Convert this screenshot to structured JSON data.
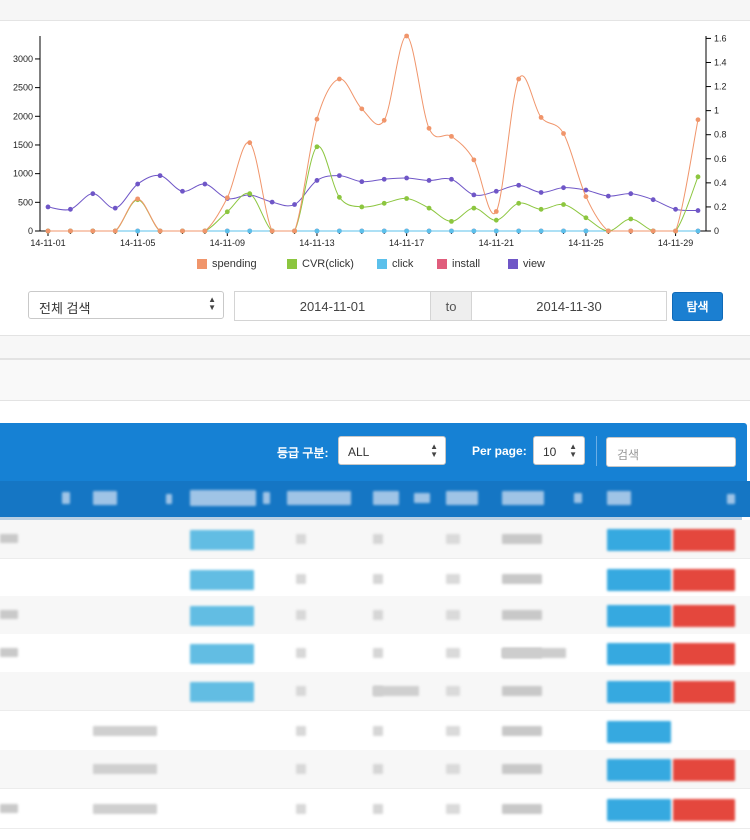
{
  "chart_data": {
    "type": "line",
    "x": [
      "14-11-01",
      "14-11-02",
      "14-11-03",
      "14-11-04",
      "14-11-05",
      "14-11-06",
      "14-11-07",
      "14-11-08",
      "14-11-09",
      "14-11-10",
      "14-11-11",
      "14-11-12",
      "14-11-13",
      "14-11-14",
      "14-11-15",
      "14-11-16",
      "14-11-17",
      "14-11-18",
      "14-11-19",
      "14-11-20",
      "14-11-21",
      "14-11-22",
      "14-11-23",
      "14-11-24",
      "14-11-25",
      "14-11-26",
      "14-11-27",
      "14-11-28",
      "14-11-29",
      "14-11-30"
    ],
    "x_tick_labels": [
      "14-11-01",
      "14-11-05",
      "14-11-09",
      "14-11-13",
      "14-11-17",
      "14-11-21",
      "14-11-25",
      "14-11-29"
    ],
    "y_left": {
      "ticks": [
        "0",
        "500",
        "1000",
        "1500",
        "2000",
        "2500",
        "3000"
      ],
      "lim": [
        0,
        3400
      ]
    },
    "y_right": {
      "ticks": [
        "0",
        "0.2",
        "0.4",
        "0.6",
        "0.8",
        "1",
        "1.2",
        "1.4",
        "1.6"
      ],
      "lim": [
        0,
        1.62
      ]
    },
    "series": [
      {
        "name": "spending",
        "axis": "left",
        "color": "#f0956b",
        "values": [
          0,
          0,
          0,
          0,
          560,
          0,
          0,
          0,
          580,
          1540,
          0,
          0,
          1950,
          2650,
          2130,
          1930,
          3400,
          1790,
          1650,
          1240,
          340,
          2650,
          1980,
          1700,
          600,
          0,
          0,
          0,
          0,
          1940
        ]
      },
      {
        "name": "CVR(click)",
        "axis": "right",
        "color": "#8cc63f",
        "values": [
          0,
          0,
          0,
          0,
          0.26,
          0,
          0,
          0,
          0.16,
          0.31,
          0,
          0,
          0.7,
          0.28,
          0.2,
          0.23,
          0.27,
          0.19,
          0.08,
          0.19,
          0.09,
          0.23,
          0.18,
          0.22,
          0.11,
          0,
          0.1,
          0,
          0,
          0.45
        ]
      },
      {
        "name": "click",
        "axis": "left",
        "color": "#5bc0eb",
        "values": [
          0,
          0,
          0,
          0,
          0,
          0,
          0,
          0,
          0,
          0,
          0,
          0,
          0,
          0,
          0,
          0,
          0,
          0,
          0,
          0,
          0,
          0,
          0,
          0,
          0,
          0,
          0,
          0,
          0,
          0
        ]
      },
      {
        "name": "install",
        "axis": "left",
        "color": "#e05d7c",
        "values": [
          0,
          0,
          0,
          0,
          0,
          0,
          0,
          0,
          0,
          0,
          0,
          0,
          0,
          0,
          0,
          0,
          0,
          0,
          0,
          0,
          0,
          0,
          0,
          0,
          0,
          0,
          0,
          0,
          0,
          0
        ]
      },
      {
        "name": "view",
        "axis": "right",
        "color": "#6f56c7",
        "values": [
          0.2,
          0.18,
          0.31,
          0.19,
          0.39,
          0.46,
          0.33,
          0.39,
          0.27,
          0.3,
          0.24,
          0.22,
          0.42,
          0.46,
          0.41,
          0.43,
          0.44,
          0.42,
          0.43,
          0.3,
          0.33,
          0.38,
          0.32,
          0.36,
          0.34,
          0.29,
          0.31,
          0.26,
          0.18,
          0.17
        ]
      }
    ]
  },
  "filters": {
    "scope_select": "전체 검색",
    "date_from": "2014-11-01",
    "date_sep": "to",
    "date_to": "2014-11-30",
    "search_button": "탐색"
  },
  "table_panel": {
    "grade_label": "등급 구분:",
    "grade_value": "ALL",
    "per_page_label": "Per page:",
    "per_page_value": "10",
    "search_placeholder": "검색"
  }
}
